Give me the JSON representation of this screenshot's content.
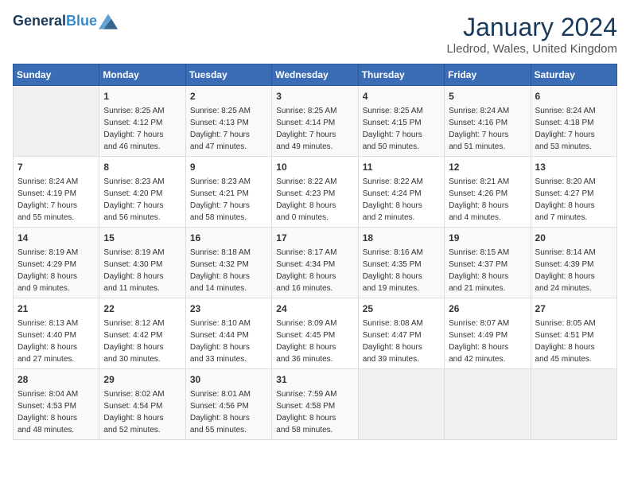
{
  "header": {
    "logo_line1": "General",
    "logo_line2": "Blue",
    "month": "January 2024",
    "location": "Lledrod, Wales, United Kingdom"
  },
  "weekdays": [
    "Sunday",
    "Monday",
    "Tuesday",
    "Wednesday",
    "Thursday",
    "Friday",
    "Saturday"
  ],
  "weeks": [
    [
      {
        "day": "",
        "info": ""
      },
      {
        "day": "1",
        "info": "Sunrise: 8:25 AM\nSunset: 4:12 PM\nDaylight: 7 hours\nand 46 minutes."
      },
      {
        "day": "2",
        "info": "Sunrise: 8:25 AM\nSunset: 4:13 PM\nDaylight: 7 hours\nand 47 minutes."
      },
      {
        "day": "3",
        "info": "Sunrise: 8:25 AM\nSunset: 4:14 PM\nDaylight: 7 hours\nand 49 minutes."
      },
      {
        "day": "4",
        "info": "Sunrise: 8:25 AM\nSunset: 4:15 PM\nDaylight: 7 hours\nand 50 minutes."
      },
      {
        "day": "5",
        "info": "Sunrise: 8:24 AM\nSunset: 4:16 PM\nDaylight: 7 hours\nand 51 minutes."
      },
      {
        "day": "6",
        "info": "Sunrise: 8:24 AM\nSunset: 4:18 PM\nDaylight: 7 hours\nand 53 minutes."
      }
    ],
    [
      {
        "day": "7",
        "info": "Sunrise: 8:24 AM\nSunset: 4:19 PM\nDaylight: 7 hours\nand 55 minutes."
      },
      {
        "day": "8",
        "info": "Sunrise: 8:23 AM\nSunset: 4:20 PM\nDaylight: 7 hours\nand 56 minutes."
      },
      {
        "day": "9",
        "info": "Sunrise: 8:23 AM\nSunset: 4:21 PM\nDaylight: 7 hours\nand 58 minutes."
      },
      {
        "day": "10",
        "info": "Sunrise: 8:22 AM\nSunset: 4:23 PM\nDaylight: 8 hours\nand 0 minutes."
      },
      {
        "day": "11",
        "info": "Sunrise: 8:22 AM\nSunset: 4:24 PM\nDaylight: 8 hours\nand 2 minutes."
      },
      {
        "day": "12",
        "info": "Sunrise: 8:21 AM\nSunset: 4:26 PM\nDaylight: 8 hours\nand 4 minutes."
      },
      {
        "day": "13",
        "info": "Sunrise: 8:20 AM\nSunset: 4:27 PM\nDaylight: 8 hours\nand 7 minutes."
      }
    ],
    [
      {
        "day": "14",
        "info": "Sunrise: 8:19 AM\nSunset: 4:29 PM\nDaylight: 8 hours\nand 9 minutes."
      },
      {
        "day": "15",
        "info": "Sunrise: 8:19 AM\nSunset: 4:30 PM\nDaylight: 8 hours\nand 11 minutes."
      },
      {
        "day": "16",
        "info": "Sunrise: 8:18 AM\nSunset: 4:32 PM\nDaylight: 8 hours\nand 14 minutes."
      },
      {
        "day": "17",
        "info": "Sunrise: 8:17 AM\nSunset: 4:34 PM\nDaylight: 8 hours\nand 16 minutes."
      },
      {
        "day": "18",
        "info": "Sunrise: 8:16 AM\nSunset: 4:35 PM\nDaylight: 8 hours\nand 19 minutes."
      },
      {
        "day": "19",
        "info": "Sunrise: 8:15 AM\nSunset: 4:37 PM\nDaylight: 8 hours\nand 21 minutes."
      },
      {
        "day": "20",
        "info": "Sunrise: 8:14 AM\nSunset: 4:39 PM\nDaylight: 8 hours\nand 24 minutes."
      }
    ],
    [
      {
        "day": "21",
        "info": "Sunrise: 8:13 AM\nSunset: 4:40 PM\nDaylight: 8 hours\nand 27 minutes."
      },
      {
        "day": "22",
        "info": "Sunrise: 8:12 AM\nSunset: 4:42 PM\nDaylight: 8 hours\nand 30 minutes."
      },
      {
        "day": "23",
        "info": "Sunrise: 8:10 AM\nSunset: 4:44 PM\nDaylight: 8 hours\nand 33 minutes."
      },
      {
        "day": "24",
        "info": "Sunrise: 8:09 AM\nSunset: 4:45 PM\nDaylight: 8 hours\nand 36 minutes."
      },
      {
        "day": "25",
        "info": "Sunrise: 8:08 AM\nSunset: 4:47 PM\nDaylight: 8 hours\nand 39 minutes."
      },
      {
        "day": "26",
        "info": "Sunrise: 8:07 AM\nSunset: 4:49 PM\nDaylight: 8 hours\nand 42 minutes."
      },
      {
        "day": "27",
        "info": "Sunrise: 8:05 AM\nSunset: 4:51 PM\nDaylight: 8 hours\nand 45 minutes."
      }
    ],
    [
      {
        "day": "28",
        "info": "Sunrise: 8:04 AM\nSunset: 4:53 PM\nDaylight: 8 hours\nand 48 minutes."
      },
      {
        "day": "29",
        "info": "Sunrise: 8:02 AM\nSunset: 4:54 PM\nDaylight: 8 hours\nand 52 minutes."
      },
      {
        "day": "30",
        "info": "Sunrise: 8:01 AM\nSunset: 4:56 PM\nDaylight: 8 hours\nand 55 minutes."
      },
      {
        "day": "31",
        "info": "Sunrise: 7:59 AM\nSunset: 4:58 PM\nDaylight: 8 hours\nand 58 minutes."
      },
      {
        "day": "",
        "info": ""
      },
      {
        "day": "",
        "info": ""
      },
      {
        "day": "",
        "info": ""
      }
    ]
  ]
}
